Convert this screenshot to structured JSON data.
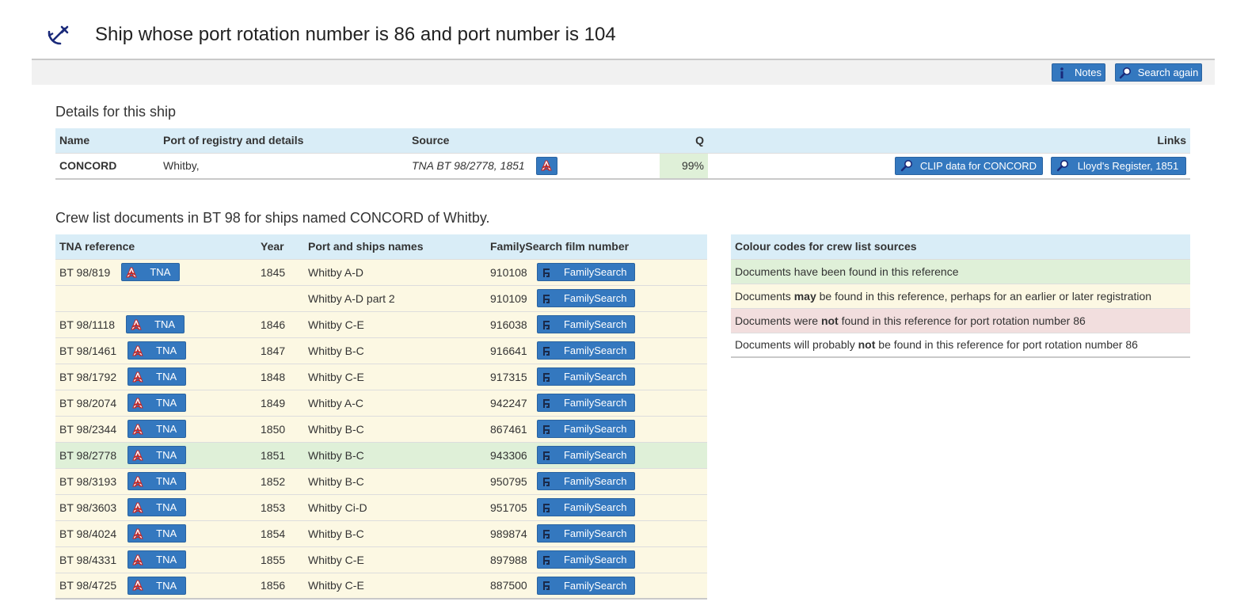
{
  "header": {
    "title": "Ship whose port rotation number is 86 and port number is 104",
    "logo_icon": "anchor-icon"
  },
  "toolbar": {
    "notes_label": "Notes",
    "search_again_label": "Search again"
  },
  "details": {
    "title": "Details for this ship",
    "columns": {
      "name": "Name",
      "port": "Port of registry and details",
      "source": "Source",
      "q": "Q",
      "links": "Links"
    },
    "row": {
      "name": "CONCORD",
      "port": "Whitby,",
      "source": "TNA BT 98/2778, 1851",
      "q": "99%",
      "clip_label": "CLIP data for CONCORD",
      "lloyds_label": "Lloyd's Register, 1851"
    }
  },
  "crew": {
    "title": "Crew list documents in BT 98 for ships named CONCORD of Whitby.",
    "columns": {
      "ref": "TNA reference",
      "year": "Year",
      "port": "Port and ships names",
      "film": "FamilySearch film number"
    },
    "tna_label": "TNA",
    "fs_label": "FamilySearch",
    "rows": [
      {
        "ref": "BT 98/819",
        "year": "1845",
        "port": "Whitby A-D",
        "film": "910108",
        "status": "may"
      },
      {
        "ref": "",
        "year": "",
        "port": "Whitby A-D part 2",
        "film": "910109",
        "status": "may"
      },
      {
        "ref": "BT 98/1118",
        "year": "1846",
        "port": "Whitby C-E",
        "film": "916038",
        "status": "may"
      },
      {
        "ref": "BT 98/1461",
        "year": "1847",
        "port": "Whitby B-C",
        "film": "916641",
        "status": "may"
      },
      {
        "ref": "BT 98/1792",
        "year": "1848",
        "port": "Whitby C-E",
        "film": "917315",
        "status": "may"
      },
      {
        "ref": "BT 98/2074",
        "year": "1849",
        "port": "Whitby A-C",
        "film": "942247",
        "status": "may"
      },
      {
        "ref": "BT 98/2344",
        "year": "1850",
        "port": "Whitby B-C",
        "film": "867461",
        "status": "may"
      },
      {
        "ref": "BT 98/2778",
        "year": "1851",
        "port": "Whitby B-C",
        "film": "943306",
        "status": "found"
      },
      {
        "ref": "BT 98/3193",
        "year": "1852",
        "port": "Whitby B-C",
        "film": "950795",
        "status": "may"
      },
      {
        "ref": "BT 98/3603",
        "year": "1853",
        "port": "Whitby Ci-D",
        "film": "951705",
        "status": "may"
      },
      {
        "ref": "BT 98/4024",
        "year": "1854",
        "port": "Whitby B-C",
        "film": "989874",
        "status": "may"
      },
      {
        "ref": "BT 98/4331",
        "year": "1855",
        "port": "Whitby C-E",
        "film": "897988",
        "status": "may"
      },
      {
        "ref": "BT 98/4725",
        "year": "1856",
        "port": "Whitby C-E",
        "film": "887500",
        "status": "may"
      }
    ]
  },
  "legend": {
    "title": "Colour codes for crew list sources",
    "rows": [
      {
        "status": "found",
        "pre": "Documents have been found in this reference",
        "bold": "",
        "post": ""
      },
      {
        "status": "may",
        "pre": "Documents ",
        "bold": "may",
        "post": " be found in this reference, perhaps for an earlier or later registration"
      },
      {
        "status": "not",
        "pre": "Documents were ",
        "bold": "not",
        "post": " found in this reference for port rotation number 86"
      },
      {
        "status": "prob",
        "pre": "Documents will probably ",
        "bold": "not",
        "post": " be found in this reference for port rotation number 86"
      }
    ]
  },
  "colors": {
    "button": "#3478bf",
    "header_bg": "#d9edf7",
    "found": "#dff0d8",
    "may": "#fcf8e3",
    "not": "#f2dede"
  }
}
